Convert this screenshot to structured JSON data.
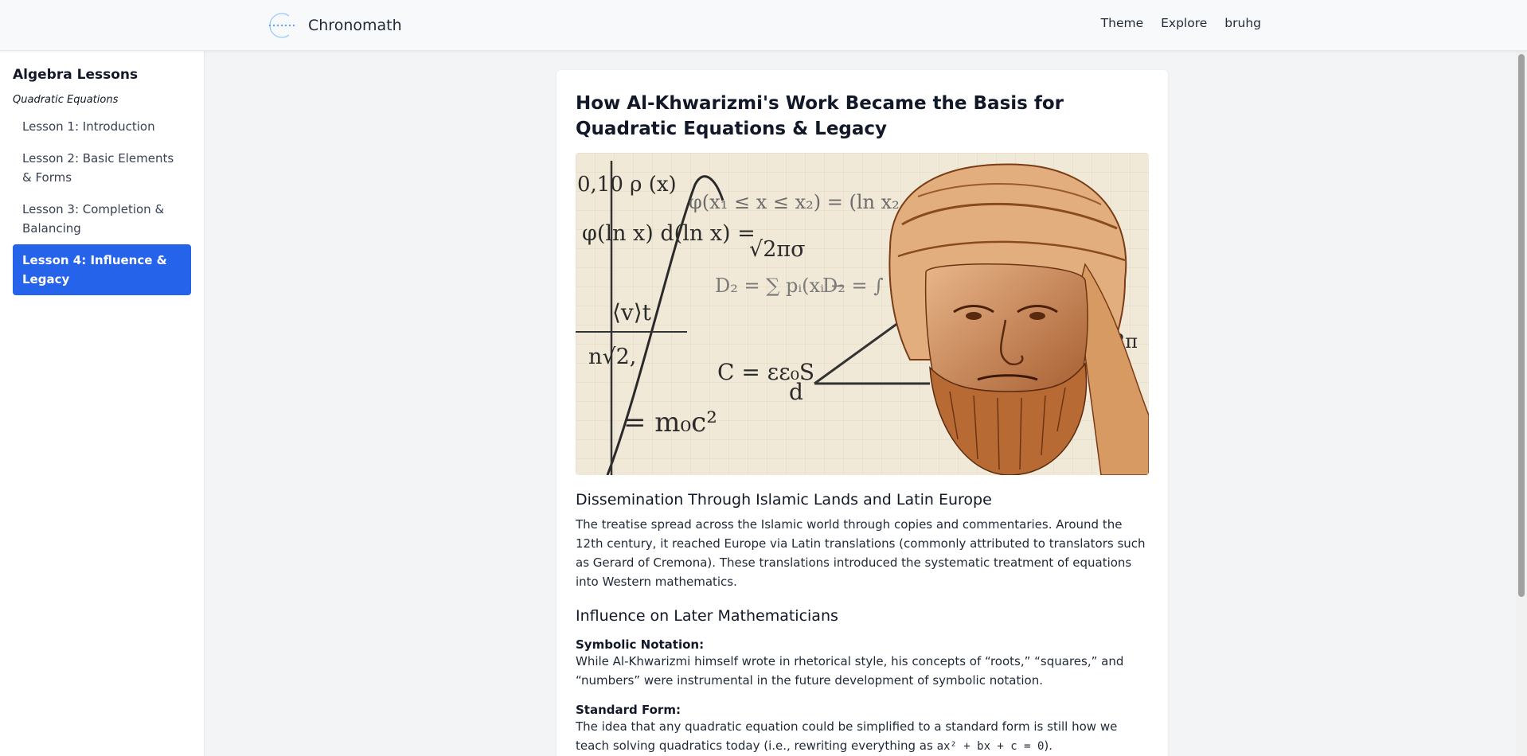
{
  "header": {
    "brand": "Chronomath",
    "nav": [
      "Theme",
      "Explore",
      "bruhg"
    ]
  },
  "sidebar": {
    "title": "Algebra Lessons",
    "section": "Quadratic Equations",
    "lessons": [
      "Lesson 1: Introduction",
      "Lesson 2: Basic Elements & Forms",
      "Lesson 3: Completion & Balancing",
      "Lesson 4: Influence & Legacy"
    ],
    "active_index": 3
  },
  "article": {
    "title": "How Al-Khwarizmi's Work Became the Basis for Quadratic Equations & Legacy",
    "image_formulas": {
      "f1": "φ(ln x) d(ln x) =",
      "f2": "√2πσ",
      "f3": "⟨v⟩t",
      "f4": "n√2,",
      "f5": "C = εε₀S",
      "f6": "d",
      "f7": "= m₀c²",
      "f8": "φ(x₁ ≤ x ≤ x₂) = (ln x₂",
      "f9": "D₂ = ∑ pᵢ(xᵢ −",
      "f10": "D₂ = ∫ (x −",
      "f11": "0,10 ρ (x)",
      "f12": "2π"
    },
    "section1": {
      "heading": "Dissemination Through Islamic Lands and Latin Europe",
      "text": "The treatise spread across the Islamic world through copies and commentaries. Around the 12th century, it reached Europe via Latin translations (commonly attributed to translators such as Gerard of Cremona). These translations introduced the systematic treatment of equations into Western mathematics."
    },
    "section2": {
      "heading": "Influence on Later Mathematicians",
      "items": [
        {
          "label": "Symbolic Notation:",
          "text": "While Al-Khwarizmi himself wrote in rhetorical style, his concepts of “roots,” “squares,” and “numbers” were instrumental in the future development of symbolic notation."
        },
        {
          "label": "Standard Form:",
          "text_before": "The idea that any quadratic equation could be simplified to a standard form is still how we teach solving quadratics today (i.e., rewriting everything as ",
          "code": "ax² + bx + c = 0",
          "text_after": ")."
        }
      ]
    }
  }
}
